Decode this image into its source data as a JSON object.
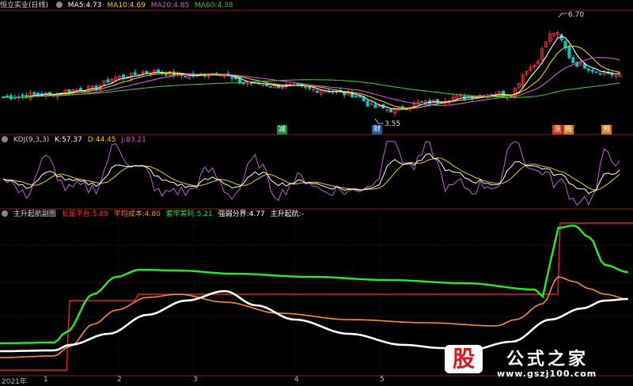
{
  "colors": {
    "bg": "#000000",
    "border": "#8b1a1a",
    "up": "#ff3333",
    "down": "#00c8c8",
    "ma5": "#ffffff",
    "ma10": "#e6d200",
    "ma20": "#d05ad0",
    "ma60": "#3bbf3b"
  },
  "main": {
    "title": "恒立实业(日线)",
    "ma5_label": "MA5:",
    "ma5_val": "4.73",
    "ma10_label": "MA10:",
    "ma10_val": "4.69",
    "ma20_label": "MA20:",
    "ma20_val": "4.85",
    "ma60_label": "MA60:",
    "ma60_val": "4.38",
    "high_mark": "6.70",
    "low_mark": "3.55",
    "signals": [
      "减",
      "财",
      "涨",
      "腾",
      "预"
    ]
  },
  "kdj": {
    "title": "KDJ(9,3,3)",
    "k_label": "K:",
    "k_val": "57.37",
    "d_label": "D:",
    "d_val": "44.45",
    "j_label": "J:",
    "j_val": "83.21"
  },
  "ind": {
    "title": "主升起航副图",
    "l1": "长量平台:",
    "v1": "5.89",
    "l2": "平均成本:",
    "v2": "4.80",
    "l3": "套牢筹码:",
    "v3": "5.21",
    "l4": "强弱分界:",
    "v4": "4.77",
    "l5": "主升起航:",
    "v5": "-"
  },
  "xaxis": [
    "2021年",
    "1",
    "2",
    "3",
    "4",
    "5"
  ],
  "watermark": {
    "logo": "股",
    "text": "公式之家",
    "url": "www.gszj100.com"
  },
  "chart_data": [
    {
      "type": "candlestick",
      "name": "price",
      "ma_values": {
        "MA5": 4.73,
        "MA10": 4.69,
        "MA20": 4.85,
        "MA60": 4.38
      },
      "high": 6.7,
      "low": 3.55
    },
    {
      "type": "line",
      "name": "KDJ(9,3,3)",
      "series": [
        {
          "name": "K",
          "last": 57.37
        },
        {
          "name": "D",
          "last": 44.45
        },
        {
          "name": "J",
          "last": 83.21
        }
      ]
    },
    {
      "type": "line",
      "name": "主升起航副图",
      "series": [
        {
          "name": "长量平台",
          "last": 5.89
        },
        {
          "name": "平均成本",
          "last": 4.8
        },
        {
          "name": "套牢筹码",
          "last": 5.21
        },
        {
          "name": "强弱分界",
          "last": 4.77
        }
      ]
    }
  ]
}
